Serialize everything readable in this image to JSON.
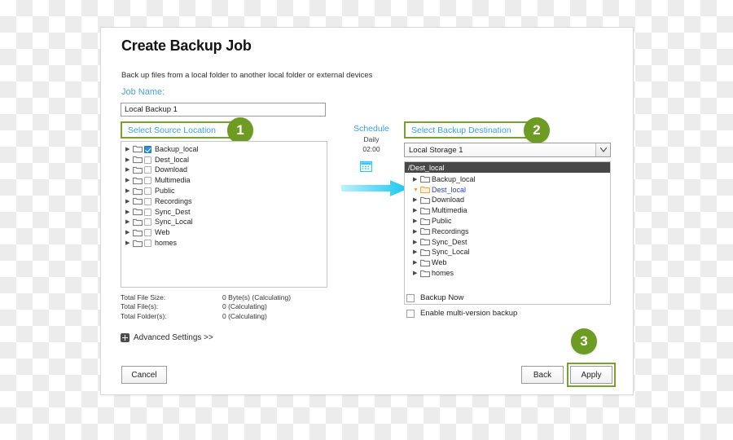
{
  "dialog": {
    "title": "Create Backup Job",
    "subtitle": "Back up files from a local folder to another local folder or external devices",
    "job_name_label": "Job Name:",
    "job_name_value": "Local Backup 1"
  },
  "steps": {
    "badge_1": "1",
    "badge_2": "2",
    "badge_3": "3"
  },
  "source": {
    "chip_label": "Select Source Location",
    "items": [
      {
        "label": "Backup_local",
        "checked": true
      },
      {
        "label": "Dest_local",
        "checked": false
      },
      {
        "label": "Download",
        "checked": false
      },
      {
        "label": "Multimedia",
        "checked": false
      },
      {
        "label": "Public",
        "checked": false
      },
      {
        "label": "Recordings",
        "checked": false
      },
      {
        "label": "Sync_Dest",
        "checked": false
      },
      {
        "label": "Sync_Local",
        "checked": false
      },
      {
        "label": "Web",
        "checked": false
      },
      {
        "label": "homes",
        "checked": false
      }
    ]
  },
  "schedule": {
    "title": "Schedule",
    "frequency": "Daily",
    "time": "02:00"
  },
  "destination": {
    "chip_label": "Select Backup Destination",
    "storage_value": "Local Storage 1",
    "path_header": "/Dest_local",
    "items": [
      {
        "label": "Backup_local",
        "selected": false
      },
      {
        "label": "Dest_local",
        "selected": true
      },
      {
        "label": "Download",
        "selected": false
      },
      {
        "label": "Multimedia",
        "selected": false
      },
      {
        "label": "Public",
        "selected": false
      },
      {
        "label": "Recordings",
        "selected": false
      },
      {
        "label": "Sync_Dest",
        "selected": false
      },
      {
        "label": "Sync_Local",
        "selected": false
      },
      {
        "label": "Web",
        "selected": false
      },
      {
        "label": "homes",
        "selected": false
      }
    ]
  },
  "stats": [
    {
      "key": "Total File Size:",
      "value": "0 Byte(s) (Calculating)"
    },
    {
      "key": "Total File(s):",
      "value": "0 (Calculating)"
    },
    {
      "key": "Total Folder(s):",
      "value": "0 (Calculating)"
    }
  ],
  "advanced_settings_label": "Advanced Settings >>",
  "options": {
    "backup_now": "Backup Now",
    "multi_version": "Enable multi-version backup"
  },
  "buttons": {
    "cancel": "Cancel",
    "back": "Back",
    "apply": "Apply"
  },
  "colors": {
    "accent_green": "#6d9b24",
    "link_blue": "#3aa0e4",
    "arrow_cyan": "#35d2f2",
    "selected_folder_orange": "#e8a33d",
    "checkbox_blue": "#2a8fe0"
  }
}
